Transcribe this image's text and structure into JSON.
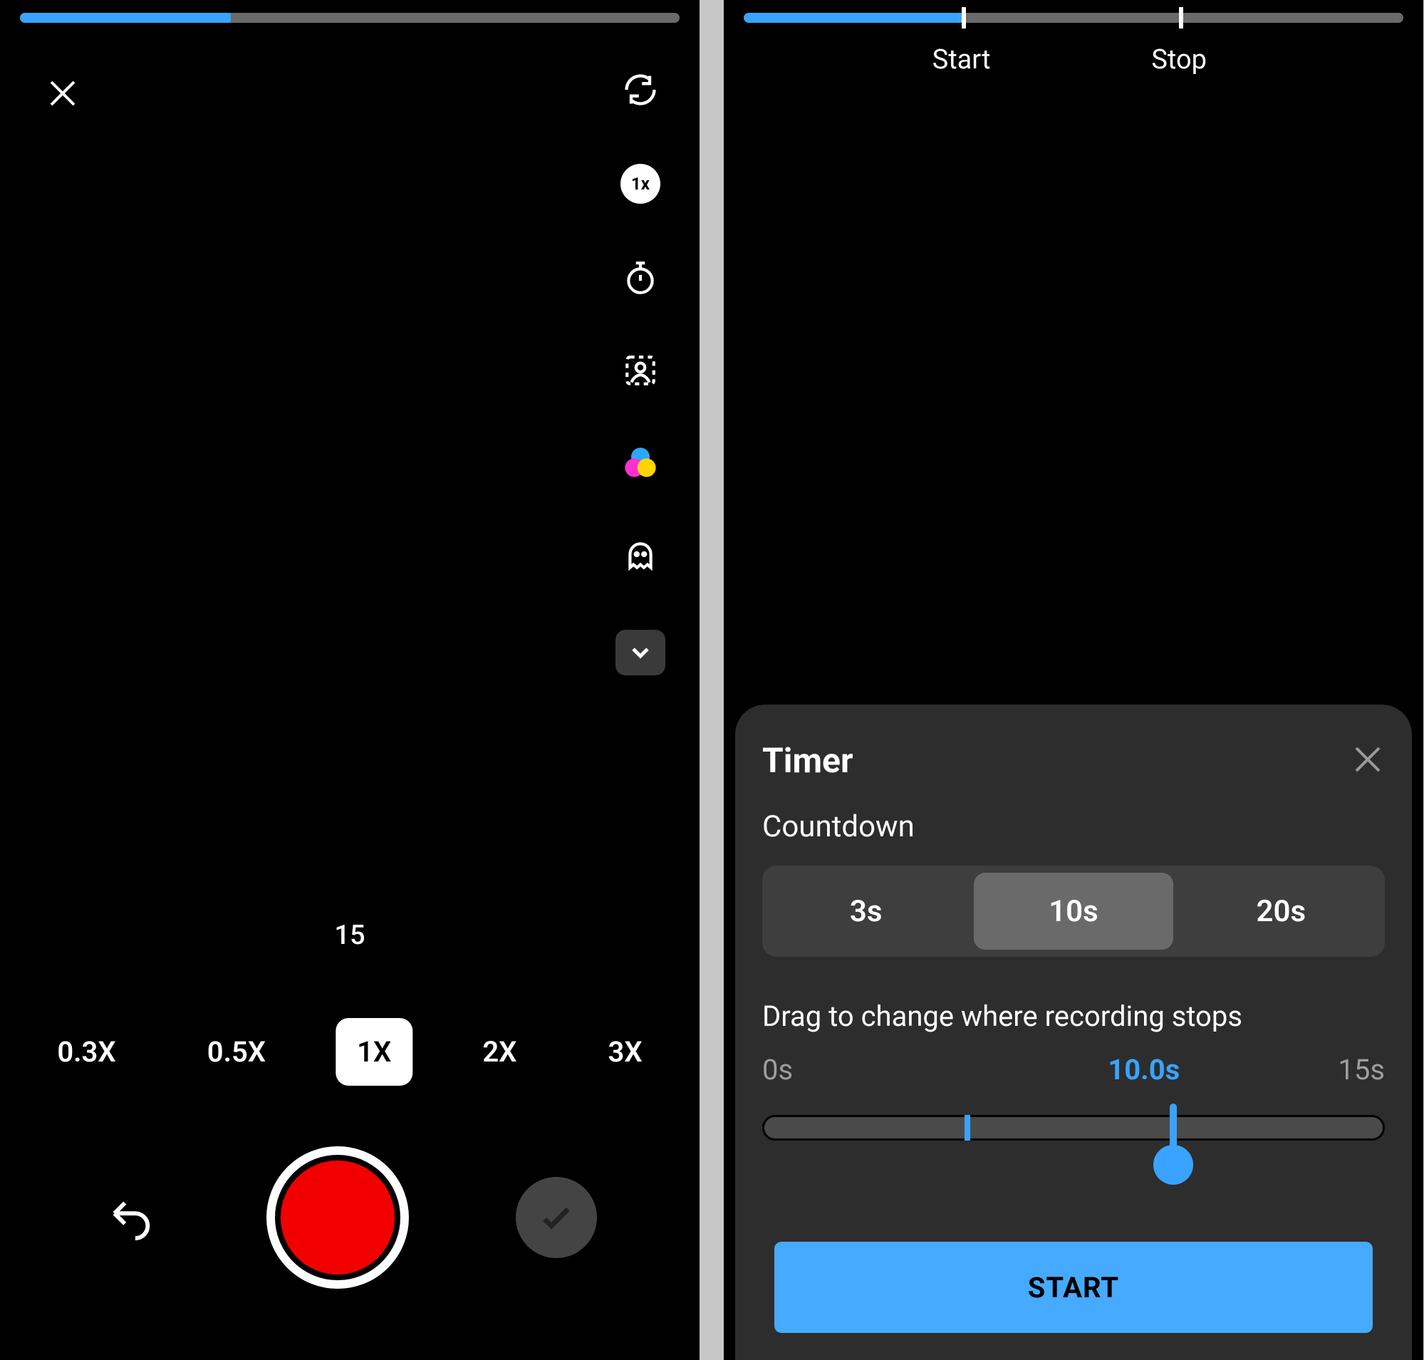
{
  "left": {
    "progress_percent": 32,
    "segments_label": "15",
    "zoom_levels": [
      "0.3X",
      "0.5X",
      "1X",
      "2X",
      "3X"
    ],
    "zoom_active_index": 2,
    "tools": {
      "speed_badge": "1x"
    }
  },
  "right": {
    "progress_percent": 33,
    "markers": {
      "start": {
        "label": "Start",
        "percent": 33
      },
      "stop": {
        "label": "Stop",
        "percent": 66
      }
    },
    "timer": {
      "title": "Timer",
      "countdown_label": "Countdown",
      "options": [
        "3s",
        "10s",
        "20s"
      ],
      "active_option_index": 1,
      "drag_label": "Drag to change where recording stops",
      "range_min": "0s",
      "range_max": "15s",
      "current_value": "10.0s",
      "tick_percent": 33,
      "handle_percent": 66,
      "start_button": "START"
    }
  }
}
